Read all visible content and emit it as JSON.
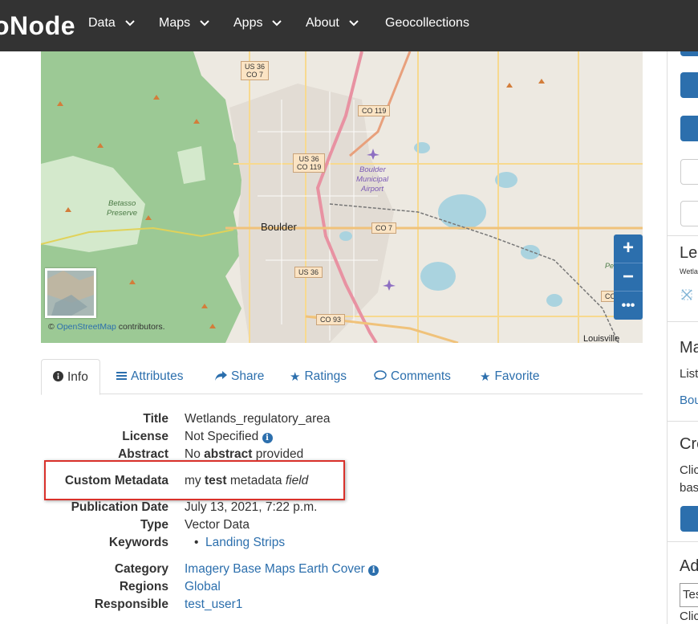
{
  "navbar": {
    "brand": "oNode",
    "items": [
      {
        "label": "Data"
      },
      {
        "label": "Maps"
      },
      {
        "label": "Apps"
      },
      {
        "label": "About"
      },
      {
        "label": "Geocollections"
      }
    ]
  },
  "map": {
    "place_labels": {
      "boulder": "Boulder",
      "betasso": "Betasso",
      "preserve": "Preserve",
      "airport1": "Boulder",
      "airport2": "Municipal",
      "airport3": "Airport",
      "louisville": "Louisville",
      "pe": "Pe"
    },
    "shields": {
      "us36_top": "US 36",
      "co7_top": "CO 7",
      "co119_top": "CO 119",
      "us36_mid": "US 36",
      "co119_mid": "CO 119",
      "co7_mid": "CO 7",
      "us36_low": "US 36",
      "co93": "CO 93",
      "co_edge": "CO"
    },
    "zoom_in": "+",
    "zoom_out": "−",
    "more": "•••",
    "attribution_prefix": "©",
    "attribution_link": "OpenStreetMap",
    "attribution_suffix": "contributors."
  },
  "tabs": [
    {
      "label": "Info",
      "icon": "info-circle-icon"
    },
    {
      "label": "Attributes",
      "icon": "list-icon"
    },
    {
      "label": "Share",
      "icon": "share-icon"
    },
    {
      "label": "Ratings",
      "icon": "star-icon"
    },
    {
      "label": "Comments",
      "icon": "comment-icon"
    },
    {
      "label": "Favorite",
      "icon": "star-icon"
    }
  ],
  "info": {
    "title_label": "Title",
    "title_value": "Wetlands_regulatory_area",
    "license_label": "License",
    "license_value": "Not Specified",
    "abstract_label": "Abstract",
    "abstract_pre": "No",
    "abstract_bold": "abstract",
    "abstract_post": "provided",
    "custom_label": "Custom Metadata",
    "custom_pre": "my",
    "custom_bold": "test",
    "custom_mid": "metadata",
    "custom_italic": "field",
    "pubdate_label": "Publication Date",
    "pubdate_value": "July 13, 2021, 7:22 p.m.",
    "type_label": "Type",
    "type_value": "Vector Data",
    "keywords_label": "Keywords",
    "keyword_1": "Landing Strips",
    "category_label": "Category",
    "category_value": "Imagery Base Maps Earth Cover",
    "regions_label": "Regions",
    "regions_value": "Global",
    "responsible_label": "Responsible",
    "responsible_value": "test_user1"
  },
  "sidebar": {
    "legend_heading": "Leg",
    "legend_sub": "Wetla",
    "maps_heading": "Ma",
    "maps_text": "List",
    "maps_link": "Bou",
    "create_heading": "Cre",
    "create_text1": "Clic",
    "create_text2": "bas",
    "add_heading": "Ad",
    "add_input_value": "Tes",
    "add_text": "Clic"
  },
  "colors": {
    "navbar": "#333333",
    "link": "#2c6fad",
    "highlight": "#d9312b",
    "forest": "#8fbf84",
    "water": "#aad3df"
  }
}
